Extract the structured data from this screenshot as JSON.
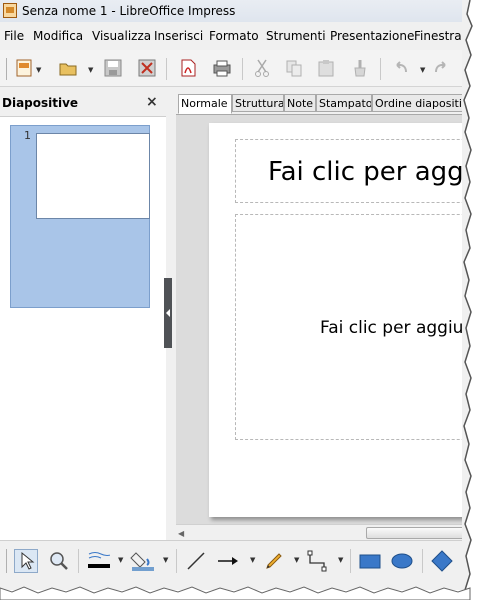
{
  "window": {
    "title": "Senza nome 1 - LibreOffice Impress"
  },
  "menu": [
    "File",
    "Modifica",
    "Visualizza",
    "Inserisci",
    "Formato",
    "Strumenti",
    "Presentazione",
    "Finestra"
  ],
  "slides_panel": {
    "title": "Diapositive",
    "close": "×",
    "slides": [
      {
        "number": "1"
      }
    ]
  },
  "view_tabs": [
    "Normale",
    "Struttura",
    "Note",
    "Stampato",
    "Ordine diapositive"
  ],
  "active_tab": "Normale",
  "slide": {
    "title_placeholder": "Fai clic per aggiungere un titolo",
    "body_placeholder": "Fai clic per aggiungere del testo"
  },
  "toolbar": {
    "icons": [
      "new-document-icon",
      "open-icon",
      "save-icon",
      "edit-file-icon",
      "export-pdf-icon",
      "print-icon",
      "cut-icon",
      "copy-icon",
      "paste-icon",
      "clone-formatting-icon",
      "undo-icon",
      "redo-icon"
    ]
  },
  "drawing_toolbar": {
    "icons": [
      "select-icon",
      "zoom-pan-icon",
      "line-color-icon",
      "fill-color-icon",
      "line-icon",
      "line-arrow-icon",
      "freeform-icon",
      "connector-icon",
      "rectangle-icon",
      "ellipse-icon",
      "basic-shapes-icon"
    ],
    "colors": {
      "line": "#000000",
      "fill": "#729fcf",
      "shapes": "#3a78c8"
    }
  }
}
